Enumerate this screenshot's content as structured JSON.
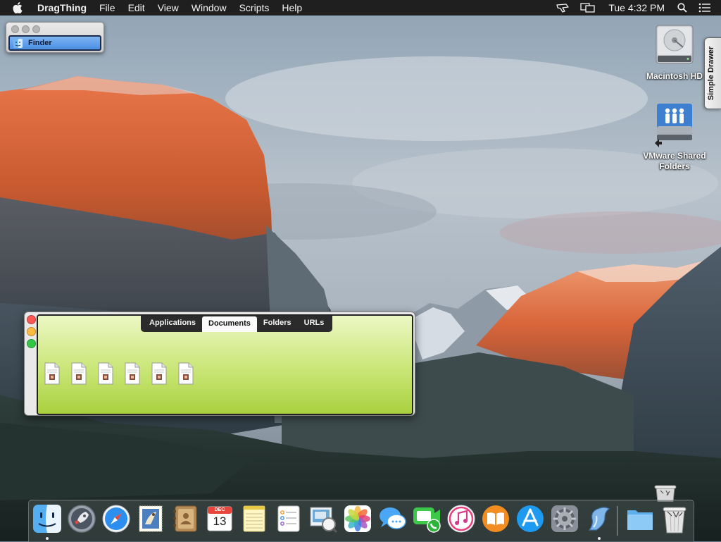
{
  "menubar": {
    "app_name": "DragThing",
    "menus": [
      "File",
      "Edit",
      "View",
      "Window",
      "Scripts",
      "Help"
    ],
    "clock": "Tue 4:32 PM"
  },
  "finder_window": {
    "item_label": "Finder"
  },
  "desktop": {
    "icons": [
      {
        "label": "Macintosh HD"
      },
      {
        "label": "VMware Shared Folders"
      }
    ]
  },
  "drawer": {
    "label": "Simple Drawer"
  },
  "dragthing_window": {
    "tabs": [
      "Applications",
      "Documents",
      "Folders",
      "URLs"
    ],
    "active_tab": "Documents",
    "document_count": 6
  },
  "dock": {
    "apps": [
      "Finder",
      "Launchpad",
      "Safari",
      "Mail",
      "Contacts",
      "Calendar",
      "Notes",
      "Reminders",
      "Preview",
      "Photos",
      "Messages",
      "FaceTime",
      "iTunes",
      "iBooks",
      "App Store",
      "System Preferences",
      "DragThing"
    ],
    "calendar_month": "DEC",
    "calendar_day": "13",
    "stacks": [
      "Downloads",
      "Trash"
    ]
  },
  "colors": {
    "menubar": "#1f1f1f",
    "dragthing_pane": "#c9e676",
    "tab_bar": "#2b2b2b",
    "close": "#fc5753",
    "minimize": "#fdbc40",
    "zoom": "#33c748"
  }
}
